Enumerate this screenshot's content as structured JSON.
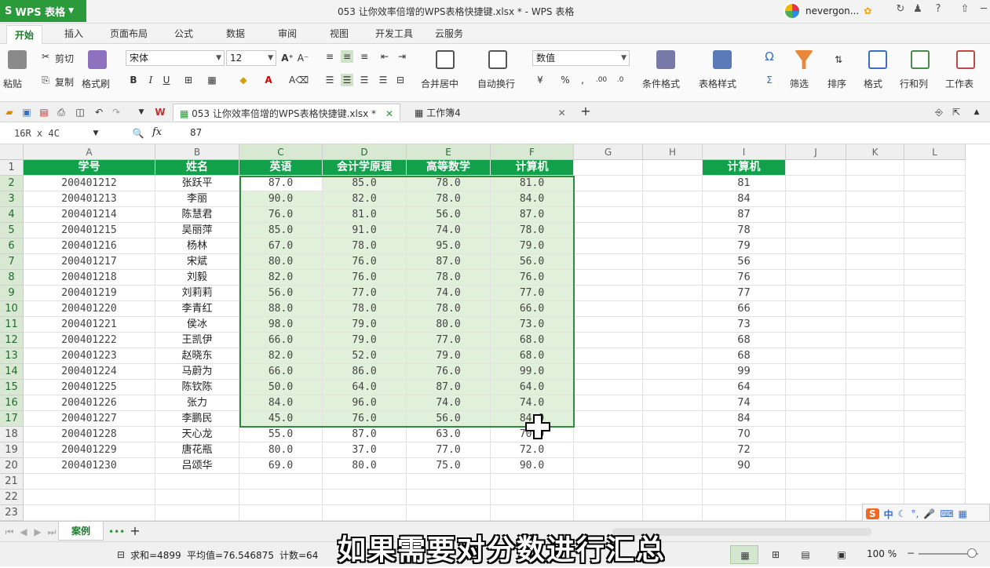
{
  "app": {
    "name": "WPS 表格",
    "window_title": "053 让你效率倍增的WPS表格快捷键.xlsx * - WPS 表格",
    "user": "nevergon..."
  },
  "ribbon_tabs": [
    "开始",
    "插入",
    "页面布局",
    "公式",
    "数据",
    "审阅",
    "视图",
    "开发工具",
    "云服务"
  ],
  "ribbon": {
    "paste": "粘贴",
    "cut": "剪切",
    "copy": "复制",
    "format_painter": "格式刷",
    "font_name": "宋体",
    "font_size": "12",
    "merge_center": "合并居中",
    "auto_wrap": "自动换行",
    "number_format": "数值",
    "cond_format": "条件格式",
    "table_style": "表格样式",
    "filter": "筛选",
    "sort": "排序",
    "format": "格式",
    "row_col": "行和列",
    "worksheet": "工作表"
  },
  "doc_tabs": [
    "053 让你效率倍增的WPS表格快捷键.xlsx *",
    "工作簿4"
  ],
  "formula_bar": {
    "name_box": "16R x 4C",
    "fx": "fx",
    "value": "87"
  },
  "columns": [
    "A",
    "B",
    "C",
    "D",
    "E",
    "F",
    "G",
    "H",
    "I",
    "J",
    "K",
    "L"
  ],
  "row_numbers": [
    "1",
    "2",
    "3",
    "4",
    "5",
    "6",
    "7",
    "8",
    "9",
    "10",
    "11",
    "12",
    "13",
    "14",
    "15",
    "16",
    "17",
    "18",
    "19",
    "20",
    "21",
    "22",
    "23"
  ],
  "headers": [
    "学号",
    "姓名",
    "英语",
    "会计学原理",
    "高等数学",
    "计算机"
  ],
  "rows": [
    [
      "200401212",
      "张跃平",
      "87.0",
      "85.0",
      "78.0",
      "81.0"
    ],
    [
      "200401213",
      "李丽",
      "90.0",
      "82.0",
      "78.0",
      "84.0"
    ],
    [
      "200401214",
      "陈慧君",
      "76.0",
      "81.0",
      "56.0",
      "87.0"
    ],
    [
      "200401215",
      "吴丽萍",
      "85.0",
      "91.0",
      "74.0",
      "78.0"
    ],
    [
      "200401216",
      "杨林",
      "67.0",
      "78.0",
      "95.0",
      "79.0"
    ],
    [
      "200401217",
      "宋斌",
      "80.0",
      "76.0",
      "87.0",
      "56.0"
    ],
    [
      "200401218",
      "刘毅",
      "82.0",
      "76.0",
      "78.0",
      "76.0"
    ],
    [
      "200401219",
      "刘莉莉",
      "56.0",
      "77.0",
      "74.0",
      "77.0"
    ],
    [
      "200401220",
      "李青红",
      "88.0",
      "78.0",
      "78.0",
      "66.0"
    ],
    [
      "200401221",
      "侯冰",
      "98.0",
      "79.0",
      "80.0",
      "73.0"
    ],
    [
      "200401222",
      "王凯伊",
      "66.0",
      "79.0",
      "77.0",
      "68.0"
    ],
    [
      "200401223",
      "赵晓东",
      "82.0",
      "52.0",
      "79.0",
      "68.0"
    ],
    [
      "200401224",
      "马蔚为",
      "66.0",
      "86.0",
      "76.0",
      "99.0"
    ],
    [
      "200401225",
      "陈钦陈",
      "50.0",
      "64.0",
      "87.0",
      "64.0"
    ],
    [
      "200401226",
      "张力",
      "84.0",
      "96.0",
      "74.0",
      "74.0"
    ],
    [
      "200401227",
      "李鹏民",
      "45.0",
      "76.0",
      "56.0",
      "84.0"
    ],
    [
      "200401228",
      "天心龙",
      "55.0",
      "87.0",
      "63.0",
      "70.0"
    ],
    [
      "200401229",
      "唐花瓶",
      "80.0",
      "37.0",
      "77.0",
      "72.0"
    ],
    [
      "200401230",
      "吕颂华",
      "69.0",
      "80.0",
      "75.0",
      "90.0"
    ]
  ],
  "col_i": {
    "header": "计算机",
    "values": [
      "81",
      "84",
      "87",
      "78",
      "79",
      "56",
      "76",
      "77",
      "66",
      "73",
      "68",
      "68",
      "99",
      "64",
      "74",
      "84",
      "70",
      "72",
      "90"
    ]
  },
  "sheet_tab": "案例",
  "status": {
    "sum": "求和=4899",
    "avg": "平均值=76.546875",
    "count": "计数=64",
    "zoom": "100 %"
  },
  "subtitle": "如果需要对分数进行汇总",
  "ime": {
    "mode": "中"
  },
  "colors": {
    "header_green": "#12a04a",
    "selection_fill": "#e1f0da",
    "app_green": "#2a9a3a"
  }
}
